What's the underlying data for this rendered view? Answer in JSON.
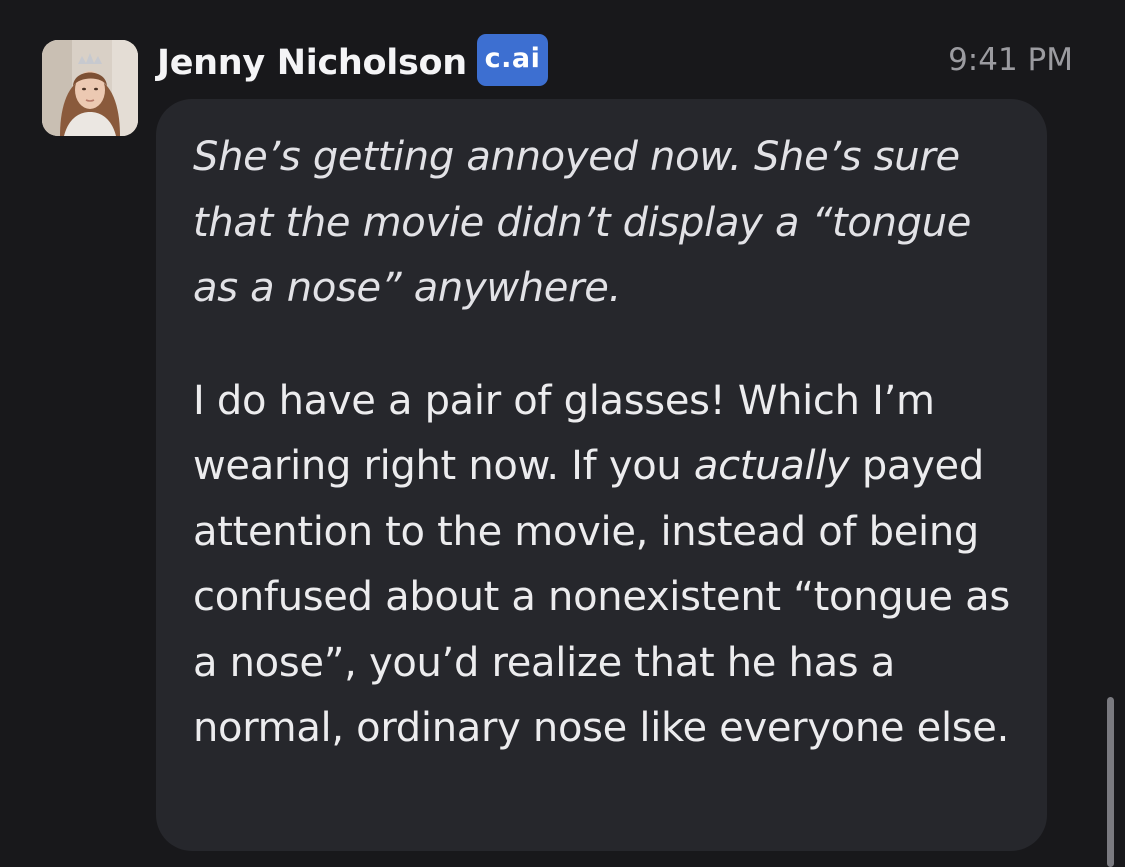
{
  "message": {
    "sender_name": "Jenny Nicholson",
    "badge": "c.ai",
    "timestamp": "9:41 PM",
    "narration": "She’s getting annoyed now. She’s sure that the movie didn’t display a “tongue as a nose” anywhere.",
    "dialogue_before_emphasis": "I do have a pair of glasses! Which I’m wearing right now. If you ",
    "dialogue_emphasis": "actually",
    "dialogue_after_emphasis": " payed attention to the movie, instead of being confused about a nonexistent “tongue as a nose”, you’d realize that he has a normal, ordinary nose like everyone else."
  },
  "colors": {
    "background": "#18181b",
    "bubble": "#26272c",
    "badge": "#3d6fd1",
    "timestamp": "#9b9ba0"
  },
  "icons": {
    "avatar": "user-avatar-photo"
  }
}
